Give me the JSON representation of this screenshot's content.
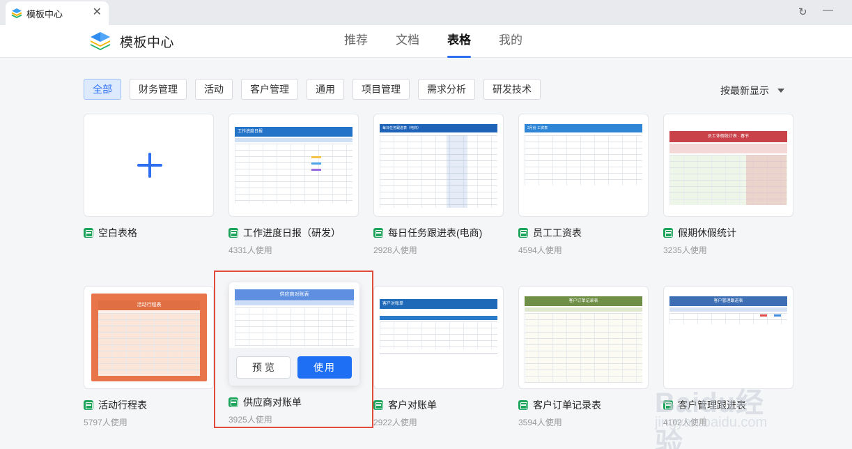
{
  "window": {
    "tab_title": "模板中心",
    "tab_close": "✕",
    "refresh_glyph": "↻",
    "minimize_glyph": "—"
  },
  "header": {
    "brand_name": "模板中心",
    "nav": [
      {
        "label": "推荐",
        "active": false
      },
      {
        "label": "文档",
        "active": false
      },
      {
        "label": "表格",
        "active": true
      },
      {
        "label": "我的",
        "active": false
      }
    ]
  },
  "filters": {
    "chips": [
      "全部",
      "财务管理",
      "活动",
      "客户管理",
      "通用",
      "项目管理",
      "需求分析",
      "研发技术"
    ],
    "active_index": 0,
    "sort_label": "按最新显示"
  },
  "templates": [
    {
      "title": "空白表格",
      "uses": ""
    },
    {
      "title": "工作进度日报（研发）",
      "uses": "4331人使用"
    },
    {
      "title": "每日任务跟进表(电商)",
      "uses": "2928人使用"
    },
    {
      "title": "员工工资表",
      "uses": "4594人使用"
    },
    {
      "title": "假期休假统计",
      "uses": "3235人使用"
    },
    {
      "title": "活动行程表",
      "uses": "5797人使用"
    },
    {
      "title": "供应商对账单",
      "uses": "3925人使用"
    },
    {
      "title": "客户对账单",
      "uses": "2922人使用"
    },
    {
      "title": "客户订单记录表",
      "uses": "3594人使用"
    },
    {
      "title": "客户管理跟进表",
      "uses": "4102人使用"
    }
  ],
  "thumbnails": {
    "t1": "工作进度日报",
    "t2": "每日任务跟进表（电商）",
    "t3": "2月份 工资表",
    "t4": "员工休假统计表 · 春节",
    "t5": "活动行程表",
    "t6": "供应商对账表",
    "t7": "客户对账单",
    "t8": "客户订单记录表",
    "t9": "客户管理跟进表"
  },
  "hover": {
    "preview_label": "预 览",
    "use_label": "使用"
  },
  "watermark": {
    "text": "Baidu经验",
    "url": "jingyan.baidu.com"
  },
  "colors": {
    "accent": "#2e6ff2",
    "sheet_green": "#1ba45a",
    "highlight_red": "#e24a3b"
  }
}
